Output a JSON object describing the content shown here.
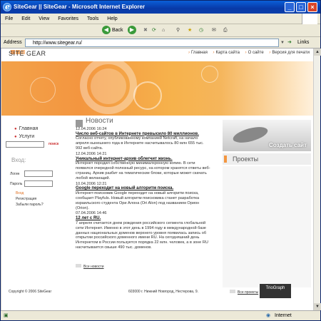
{
  "window": {
    "title": "SiteGear || SiteGear - Microsoft Internet Explorer"
  },
  "menu": [
    "File",
    "Edit",
    "View",
    "Favorites",
    "Tools",
    "Help"
  ],
  "toolbar": {
    "back_label": "Back"
  },
  "addressbar": {
    "label": "Address",
    "url": "http://www.sitegear.ru/",
    "links_label": "Links"
  },
  "site": {
    "logo_text": "SITE GEAR",
    "topnav": [
      "Главная",
      "Карта сайта",
      "О сайте",
      "Версия для печати"
    ],
    "leftnav": [
      "Главная",
      "Услуги"
    ],
    "search_button": "поиск",
    "login": {
      "heading": "Вход:",
      "login_label": "Логин",
      "password_label": "Пароль",
      "links": [
        "Вход",
        "Регистрация",
        "Забыли пароль?"
      ]
    },
    "news": {
      "heading": "Новости",
      "items": [
        {
          "date": "12.04.2006 16:24",
          "title": "Число веб-сайтов в Интернете превысило 80 миллионов.",
          "text": "Согласно отчету, опубликованному компанией Netcraft, на начало апреля нынешнего года в Интернете насчитывалось 80 млн 655 тыс. 992 веб-сайта."
        },
        {
          "date": "12.04.2006 14:21",
          "title": "Уникальный интернет-архив облегчит жизнь.",
          "text": "Интернет породил собственную минималхронную копию. В сети появился очередной полезный ресурс, на котором хранятся ответы веб-страниц. Архив разбит на тематические блоки, которые может скачать любой желающий."
        },
        {
          "date": "10.04.2006 12:21",
          "title": "Google переходит на новый алгоритм поиска.",
          "text": "Интернет-поисковик Google переходит на новый алгоритм поиска, сообщает Playfuls. Новый алгоритм поисковика станет разработка израильского студента Ори Алона (Ori Alon) под названием Орион (Orion)."
        },
        {
          "date": "07.04.2006 14:46",
          "title": "12 лет с RU.",
          "text": "7 апреля считается днем рождения российского сегмента глобальной сети Интернет. Именно в этот день в 1994 году в международной базе данных национальных доменов верхнего уровня появилась запись об открытии российского доменного имени RU. На сегодняшний день Интернетом в России пользуется порядка 22 млн. человек, а в зоне RU насчитывается свыше 490 тыс. доменов."
        }
      ],
      "all_link": "Все новости"
    },
    "ad_text": "Создать сайт",
    "projects": {
      "heading": "Проекты",
      "all_link": "Все проекты"
    },
    "footer": {
      "copyright": "Copyright © 2006 SiteGear",
      "address": "603000 г. Нижний Новгород, Нестерова, 9.",
      "badge": "TrioGraph"
    }
  },
  "status": {
    "zone": "Internet"
  }
}
